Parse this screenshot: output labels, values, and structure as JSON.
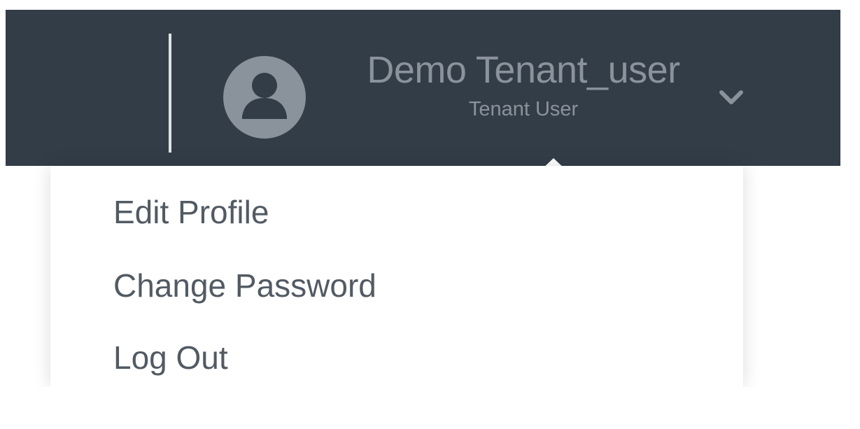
{
  "header": {
    "user_name": "Demo Tenant_user",
    "user_role": "Tenant User",
    "avatar_icon": "user-avatar-icon",
    "dropdown_icon": "chevron-down-icon"
  },
  "user_menu": {
    "items": [
      {
        "label": "Edit Profile"
      },
      {
        "label": "Change Password"
      },
      {
        "label": "Log Out"
      }
    ]
  },
  "colors": {
    "header_background": "#333d48",
    "header_text": "#8a929b",
    "menu_background": "#ffffff",
    "menu_text": "#525a63"
  }
}
